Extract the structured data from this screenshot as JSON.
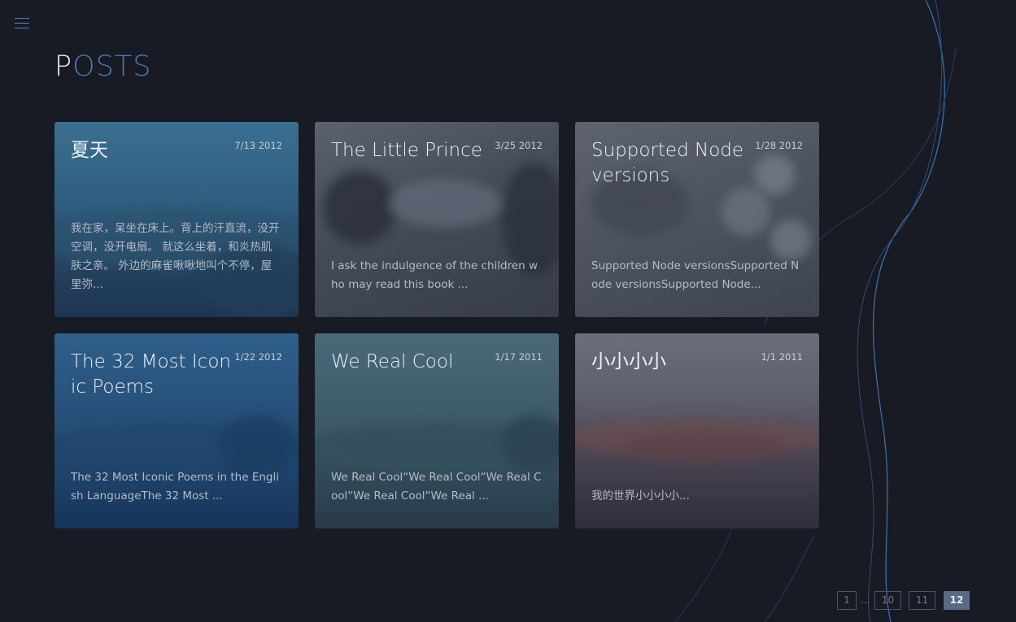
{
  "header": {
    "title_first": "P",
    "title_rest": "OSTS",
    "menu_icon": "hamburger-menu-icon"
  },
  "posts": [
    {
      "title": "夏天",
      "date": "7/13 2012",
      "excerpt": "我在家，呆坐在床上。背上的汗直流，没开空调，没开电扇。 就这么坐着，和炎热肌肤之亲。 外边的麻雀啾啾地叫个不停，屋里弥..."
    },
    {
      "title": "The Little Prince",
      "date": "3/25 2012",
      "excerpt": "I ask the indulgence of the children who may read this book ..."
    },
    {
      "title": "Supported Node versions",
      "date": "1/28 2012",
      "excerpt": "Supported Node versionsSupported Node versionsSupported Node..."
    },
    {
      "title": "The 32 Most Iconic Poems",
      "date": "1/22 2012",
      "excerpt": "The 32 Most Iconic Poems in the English LanguageThe 32 Most ..."
    },
    {
      "title": "We Real Cool",
      "date": "1/17 2011",
      "excerpt": "We Real Cool“We Real Cool“We Real Cool“We Real Cool“We Real ..."
    },
    {
      "title": "小小小小",
      "date": "1/1 2011",
      "excerpt": "我的世界小小小小..."
    }
  ],
  "pagination": {
    "first": "1",
    "ellipsis": "...",
    "p10": "10",
    "p11": "11",
    "current": "12"
  },
  "colors": {
    "background": "#181b24",
    "accent": "#4a78b3",
    "pager_active": "#5a6a85"
  }
}
